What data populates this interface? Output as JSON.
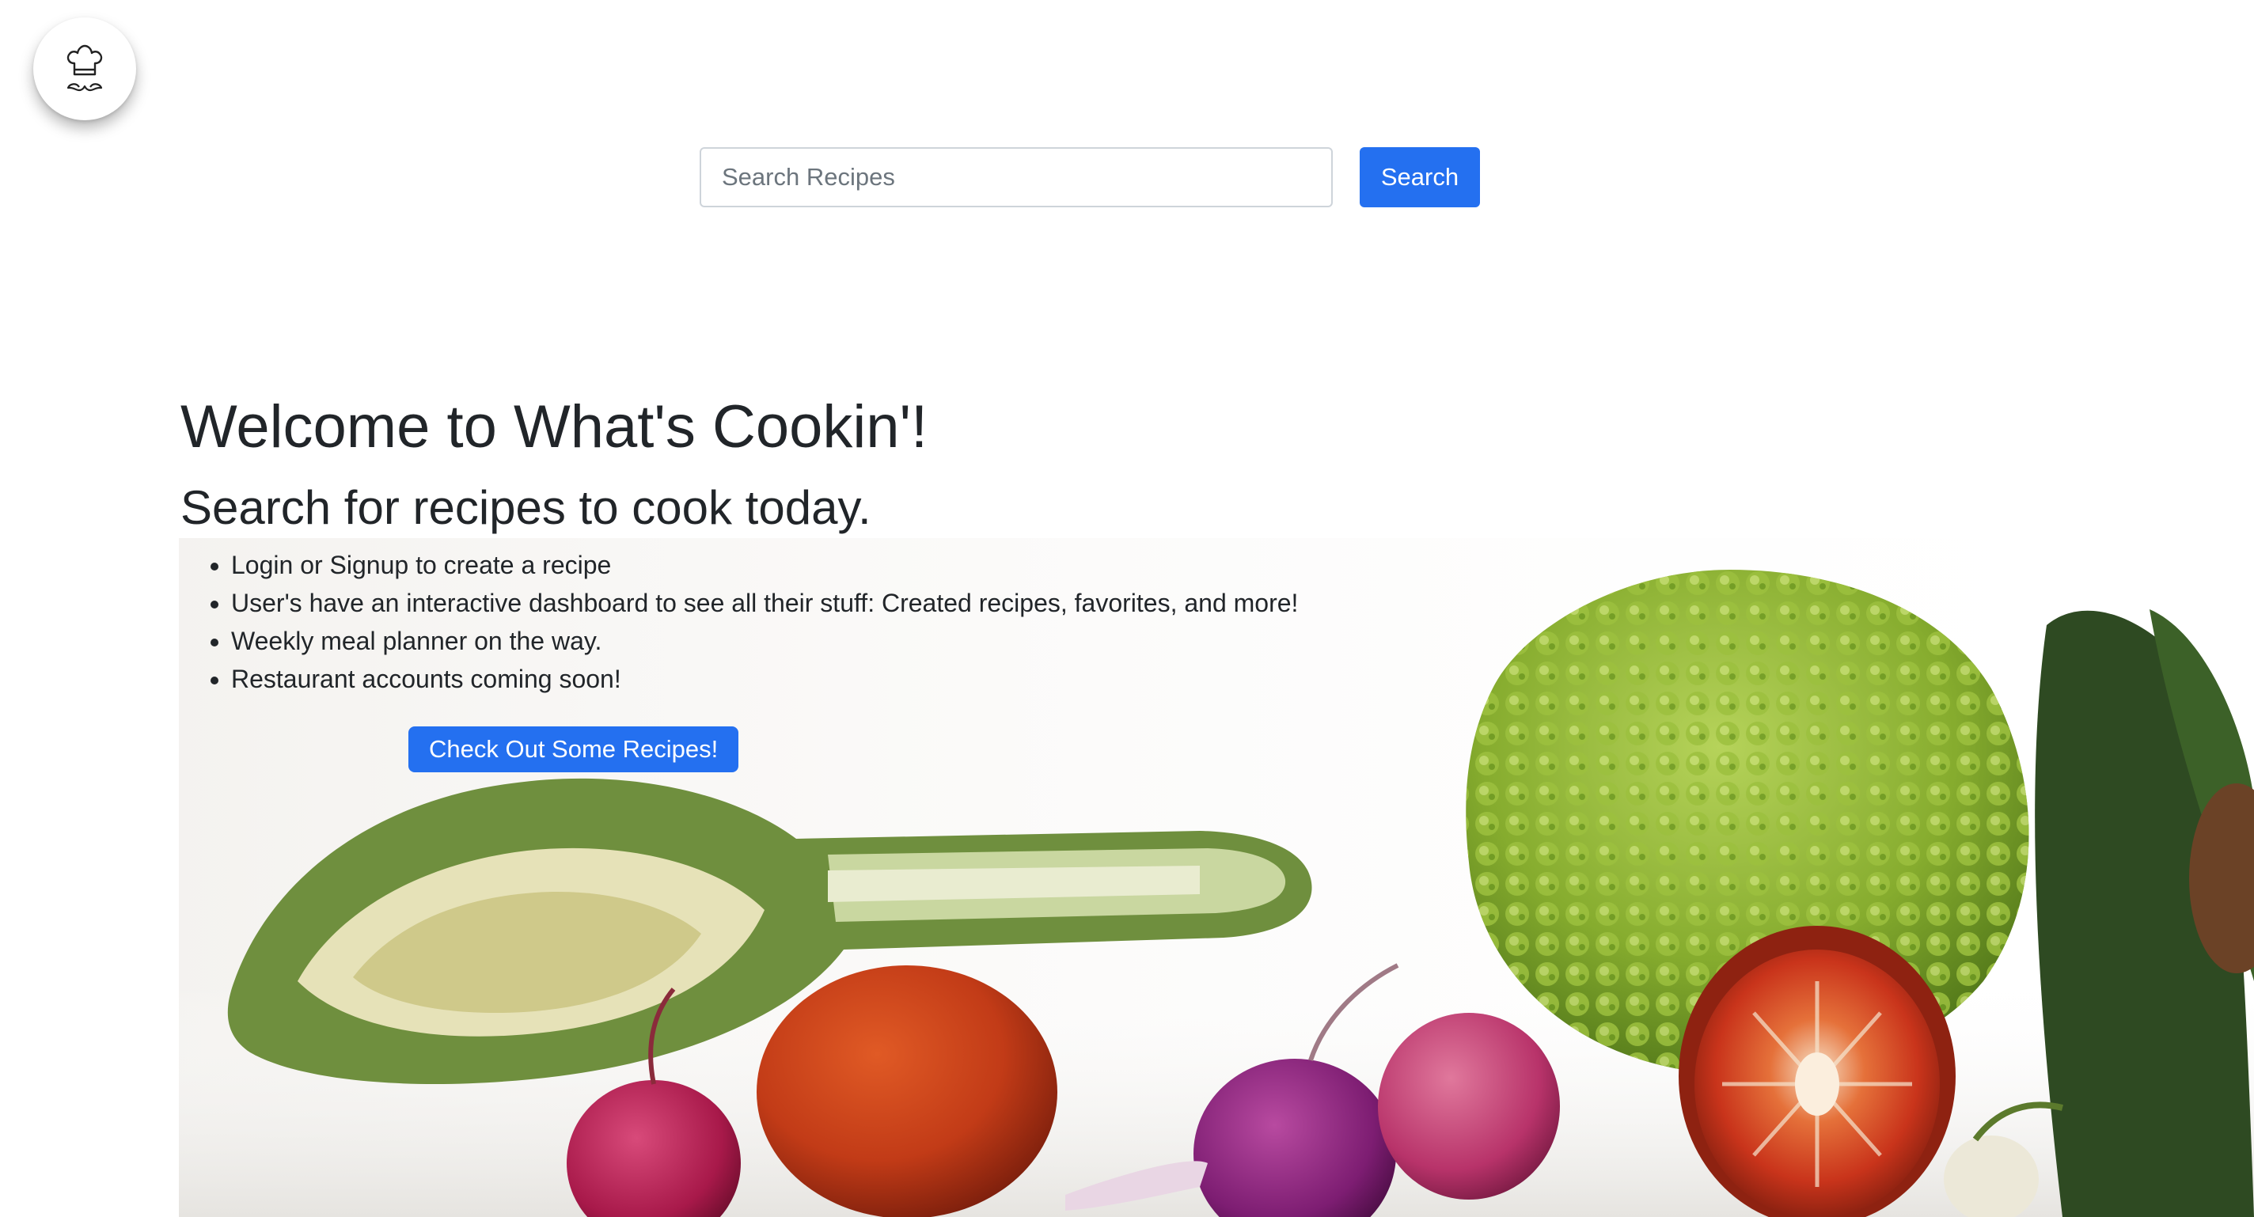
{
  "header": {
    "logo_icon": "chef-hat-mustache-icon"
  },
  "search": {
    "placeholder": "Search Recipes",
    "value": "",
    "button_label": "Search"
  },
  "welcome": {
    "title": "Welcome to What's Cookin'!",
    "subtitle": "Search for recipes to cook today.",
    "features": [
      "Login or Signup to create a recipe",
      "User's have an interactive dashboard to see all their stuff: Created recipes, favorites, and more!",
      "Weekly meal planner on the way.",
      "Restaurant accounts coming soon!"
    ],
    "cta_label": "Check Out Some Recipes!"
  },
  "colors": {
    "primary": "#2470f0",
    "text": "#212529",
    "input_border": "#ced4da"
  }
}
